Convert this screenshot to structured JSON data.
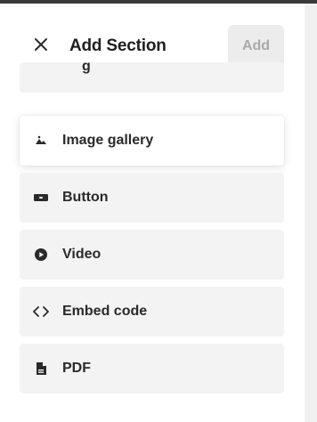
{
  "header": {
    "title": "Add Section",
    "add_label": "Add"
  },
  "icons": {
    "close": "close-icon",
    "image_gallery": "image-icon",
    "button": "button-icon",
    "video": "play-circle-icon",
    "embed": "code-icon",
    "pdf": "document-icon"
  },
  "items": [
    {
      "label": "Image gallery"
    },
    {
      "label": "Button"
    },
    {
      "label": "Video"
    },
    {
      "label": "Embed code"
    },
    {
      "label": "PDF"
    }
  ],
  "colors": {
    "item_background": "#f3f3f3",
    "disabled_button_bg": "#ececec",
    "disabled_button_text": "#a9a9a9"
  }
}
